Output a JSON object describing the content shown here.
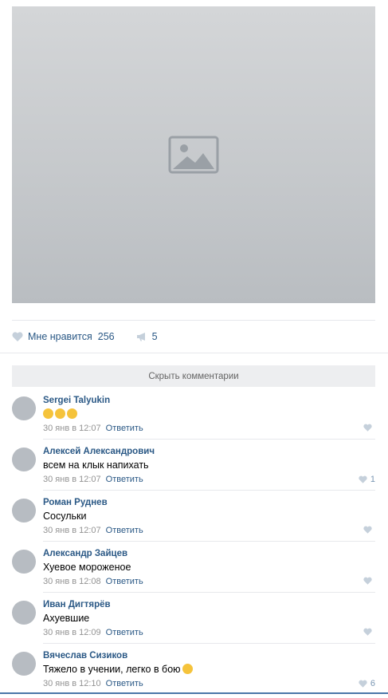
{
  "post": {
    "photo_icon": "image-icon",
    "likes_label": "Мне нравится",
    "likes_count": "256",
    "shares_count": "5"
  },
  "hide_comments_label": "Скрыть комментарии",
  "comments": [
    {
      "name": "Sergei Talyukin",
      "text": "",
      "emoji_count": 3,
      "date": "30 янв в 12:07",
      "reply": "Ответить",
      "likes": ""
    },
    {
      "name": "Алексей Александрович",
      "text": "всем на клык напихать",
      "date": "30 янв в 12:07",
      "reply": "Ответить",
      "likes": "1"
    },
    {
      "name": "Роман Руднев",
      "text": "Сосульки",
      "date": "30 янв в 12:07",
      "reply": "Ответить",
      "likes": ""
    },
    {
      "name": "Александр Зайцев",
      "text": "Хуевое мороженое",
      "date": "30 янв в 12:08",
      "reply": "Ответить",
      "likes": ""
    },
    {
      "name": "Иван Дигтярёв",
      "text": "Ахуевшие",
      "date": "30 янв в 12:09",
      "reply": "Ответить",
      "likes": ""
    },
    {
      "name": "Вячеслав Сизиков",
      "text": "Тяжело в учении, легко в бою",
      "date": "30 янв в 12:10",
      "reply": "Ответить",
      "likes": "6"
    }
  ],
  "icons": {
    "like": "heart-icon",
    "share": "megaphone-icon",
    "avatar": "user-avatar"
  },
  "colors": {
    "link": "#2a5885",
    "muted": "#939393",
    "bar": "#edeef0",
    "like_icon": "#c5d0db"
  }
}
